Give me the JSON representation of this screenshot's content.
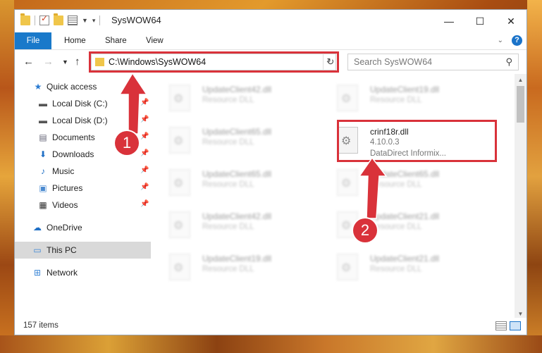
{
  "window": {
    "title": "SysWOW64"
  },
  "ribbon": {
    "tabs": [
      "File",
      "Home",
      "Share",
      "View"
    ]
  },
  "address": {
    "path": "C:\\Windows\\SysWOW64"
  },
  "search": {
    "placeholder": "Search SysWOW64"
  },
  "sidebar": {
    "items": [
      {
        "label": "Quick access",
        "icon": "star-icon",
        "pinned": false
      },
      {
        "label": "Local Disk (C:)",
        "icon": "drive-icon",
        "pinned": true
      },
      {
        "label": "Local Disk (D:)",
        "icon": "drive-icon",
        "pinned": true
      },
      {
        "label": "Documents",
        "icon": "documents-icon",
        "pinned": true
      },
      {
        "label": "Downloads",
        "icon": "download-icon",
        "pinned": true
      },
      {
        "label": "Music",
        "icon": "music-icon",
        "pinned": true
      },
      {
        "label": "Pictures",
        "icon": "pictures-icon",
        "pinned": true
      },
      {
        "label": "Videos",
        "icon": "videos-icon",
        "pinned": true
      },
      {
        "label": "OneDrive",
        "icon": "cloud-icon",
        "pinned": false
      },
      {
        "label": "This PC",
        "icon": "computer-icon",
        "pinned": false,
        "selected": true
      },
      {
        "label": "Network",
        "icon": "network-icon",
        "pinned": false
      }
    ]
  },
  "files": [
    {
      "name": "UpdateClient42.dll",
      "desc": "Resource DLL"
    },
    {
      "name": "UpdateClient19.dll",
      "desc": "Resource DLL"
    },
    {
      "name": "UpdateClient65.dll",
      "desc": "Resource DLL"
    },
    {
      "name": "crinf18r.dll",
      "desc": "4.10.0.3",
      "desc2": "DataDirect Informix...",
      "highlighted": true
    },
    {
      "name": "UpdateClient65.dll",
      "desc": "Resource DLL"
    },
    {
      "name": "UpdateClient65.dll",
      "desc": "Resource DLL"
    },
    {
      "name": "UpdateClient42.dll",
      "desc": "Resource DLL"
    },
    {
      "name": "UpdateClient21.dll",
      "desc": "Resource DLL"
    },
    {
      "name": "UpdateClient19.dll",
      "desc": "Resource DLL"
    },
    {
      "name": "UpdateClient21.dll",
      "desc": "Resource DLL"
    }
  ],
  "status": {
    "item_count": "157 items"
  },
  "annotations": {
    "step1": "1",
    "step2": "2"
  },
  "colors": {
    "accent": "#1979ca",
    "highlight": "#d9323a"
  }
}
